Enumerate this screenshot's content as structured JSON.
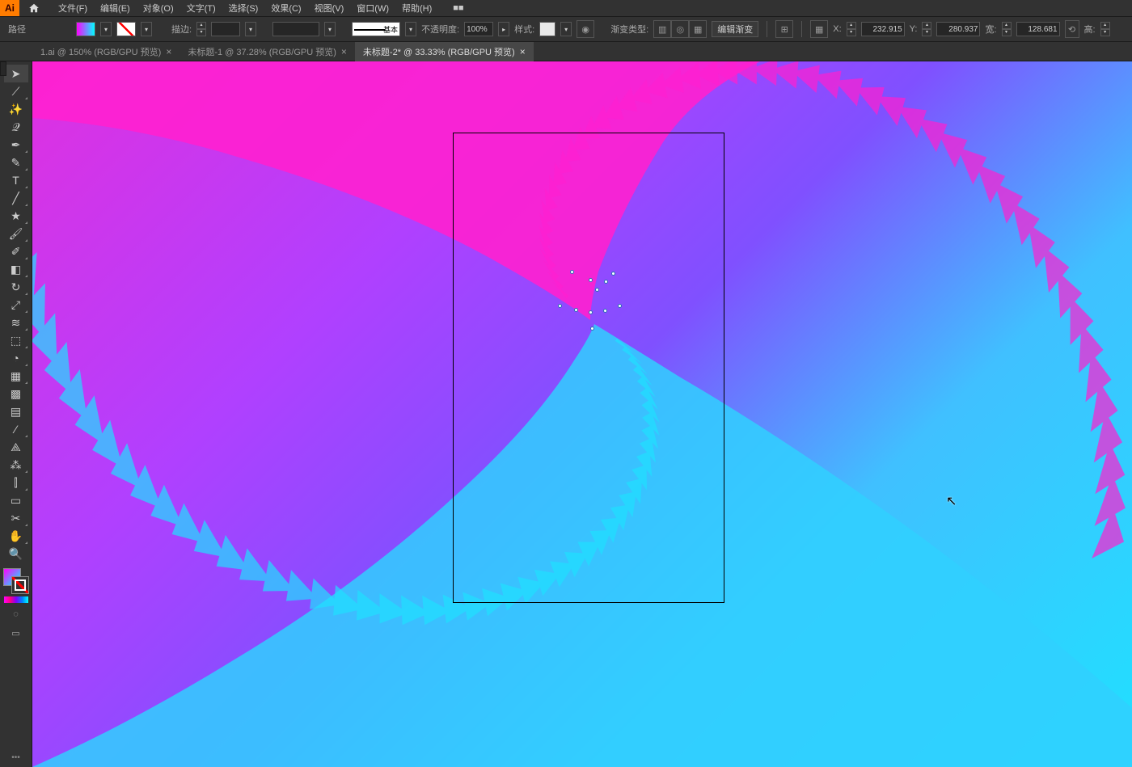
{
  "menu": {
    "items": [
      "文件(F)",
      "编辑(E)",
      "对象(O)",
      "文字(T)",
      "选择(S)",
      "效果(C)",
      "视图(V)",
      "窗口(W)",
      "帮助(H)"
    ],
    "extra": "■■"
  },
  "control": {
    "path_label": "路径",
    "stroke_label": "描边:",
    "stroke_value": "",
    "stroke_style_label": "基本",
    "opacity_label": "不透明度:",
    "opacity_value": "100%",
    "style_label": "样式:",
    "gradient_type_label": "渐变类型:",
    "edit_gradient": "编辑渐变",
    "x_label": "X:",
    "x_value": "232.915",
    "y_label": "Y:",
    "y_value": "280.937",
    "w_label": "宽:",
    "w_value": "128.681",
    "h_label": "高:"
  },
  "tabs": [
    {
      "label": "1.ai @ 150% (RGB/GPU 预览)",
      "active": false
    },
    {
      "label": "未标题-1 @ 37.28% (RGB/GPU 预览)",
      "active": false
    },
    {
      "label": "未标题-2* @ 33.33% (RGB/GPU 预览)",
      "active": true
    }
  ],
  "tools": [
    {
      "name": "selection-tool",
      "glyph": "➤",
      "corner": false,
      "active": true
    },
    {
      "name": "direct-selection-tool",
      "glyph": "⟋",
      "corner": true,
      "active": false
    },
    {
      "name": "magic-wand-tool",
      "glyph": "✨",
      "corner": false,
      "active": false
    },
    {
      "name": "lasso-tool",
      "glyph": "𝒬",
      "corner": false,
      "active": false
    },
    {
      "name": "pen-tool",
      "glyph": "✒",
      "corner": true,
      "active": false
    },
    {
      "name": "curvature-tool",
      "glyph": "✎",
      "corner": true,
      "active": false
    },
    {
      "name": "type-tool",
      "glyph": "T",
      "corner": true,
      "active": false
    },
    {
      "name": "line-tool",
      "glyph": "╱",
      "corner": true,
      "active": false
    },
    {
      "name": "star-tool",
      "glyph": "★",
      "corner": true,
      "active": false
    },
    {
      "name": "paintbrush-tool",
      "glyph": "🖌",
      "corner": true,
      "active": false
    },
    {
      "name": "pencil-tool",
      "glyph": "✐",
      "corner": true,
      "active": false
    },
    {
      "name": "eraser-tool",
      "glyph": "◧",
      "corner": true,
      "active": false
    },
    {
      "name": "rotate-tool",
      "glyph": "↻",
      "corner": true,
      "active": false
    },
    {
      "name": "scale-tool",
      "glyph": "⤢",
      "corner": true,
      "active": false
    },
    {
      "name": "width-tool",
      "glyph": "≋",
      "corner": true,
      "active": false
    },
    {
      "name": "free-transform-tool",
      "glyph": "⬚",
      "corner": true,
      "active": false
    },
    {
      "name": "shape-builder-tool",
      "glyph": "◔",
      "corner": true,
      "active": false
    },
    {
      "name": "perspective-tool",
      "glyph": "▦",
      "corner": true,
      "active": false
    },
    {
      "name": "mesh-tool",
      "glyph": "▩",
      "corner": false,
      "active": false
    },
    {
      "name": "gradient-tool",
      "glyph": "▤",
      "corner": false,
      "active": false
    },
    {
      "name": "eyedropper-tool",
      "glyph": "⁄",
      "corner": true,
      "active": false
    },
    {
      "name": "blend-tool",
      "glyph": "⟁",
      "corner": false,
      "active": false
    },
    {
      "name": "symbol-sprayer-tool",
      "glyph": "⁂",
      "corner": true,
      "active": false
    },
    {
      "name": "graph-tool",
      "glyph": "⫿",
      "corner": true,
      "active": false
    },
    {
      "name": "artboard-tool",
      "glyph": "▭",
      "corner": false,
      "active": false
    },
    {
      "name": "slice-tool",
      "glyph": "✂",
      "corner": true,
      "active": false
    },
    {
      "name": "hand-tool",
      "glyph": "✋",
      "corner": true,
      "active": false
    },
    {
      "name": "zoom-tool",
      "glyph": "🔍",
      "corner": false,
      "active": false
    }
  ],
  "anchors": [
    {
      "l": 665,
      "t": 258
    },
    {
      "l": 716,
      "t": 260
    },
    {
      "l": 707,
      "t": 270
    },
    {
      "l": 688,
      "t": 268
    },
    {
      "l": 696,
      "t": 280
    },
    {
      "l": 650,
      "t": 300
    },
    {
      "l": 670,
      "t": 305
    },
    {
      "l": 688,
      "t": 308
    },
    {
      "l": 706,
      "t": 306
    },
    {
      "l": 724,
      "t": 300
    },
    {
      "l": 690,
      "t": 328
    }
  ]
}
